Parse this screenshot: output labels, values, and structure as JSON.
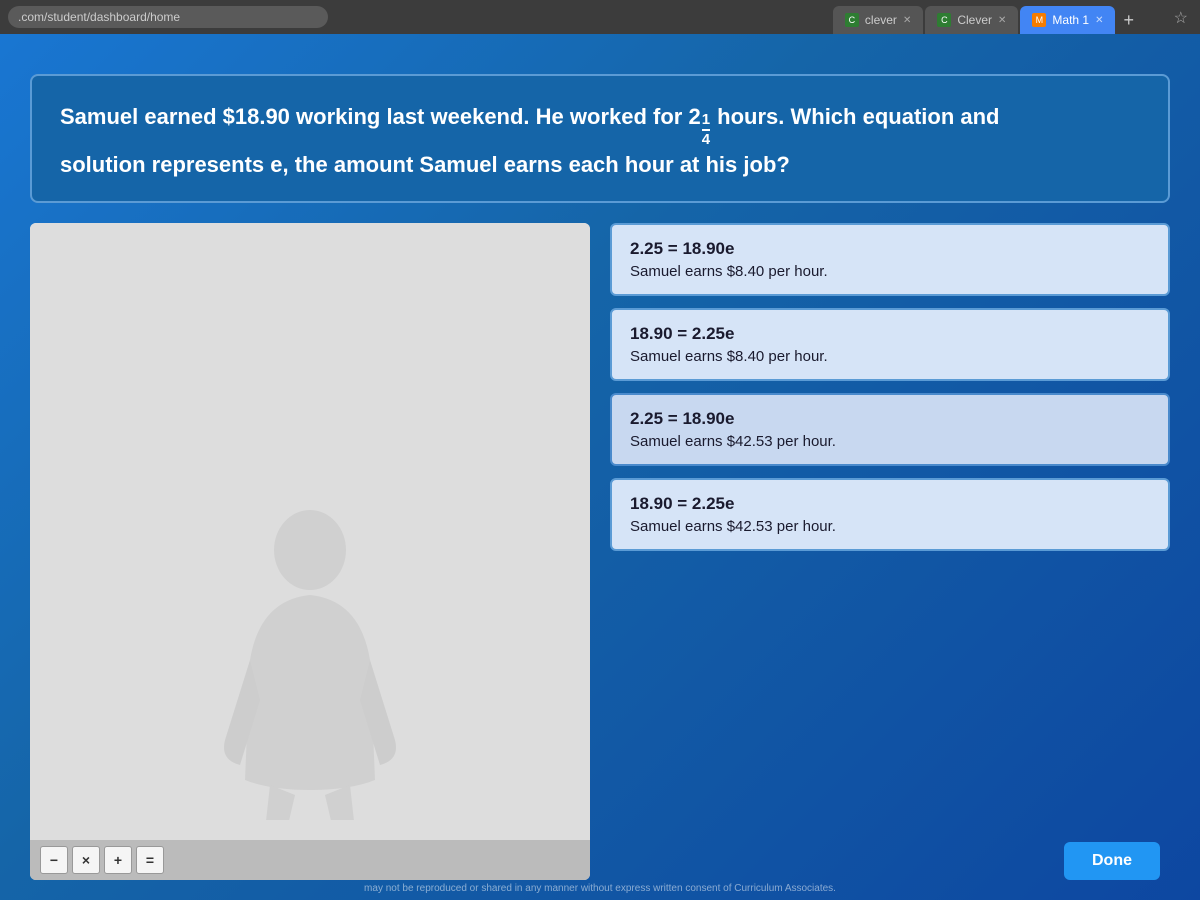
{
  "browser": {
    "url": ".com/student/dashboard/home",
    "tabs": [
      {
        "label": "clever",
        "favicon": "C",
        "faviconColor": "green",
        "active": false
      },
      {
        "label": "Clever",
        "favicon": "C",
        "faviconColor": "green",
        "active": false
      },
      {
        "label": "Math 1",
        "favicon": "M",
        "faviconColor": "orange",
        "active": true
      }
    ],
    "plus_label": "+"
  },
  "question": {
    "text_part1": "Samuel earned $18.90 working last weekend. He worked for 2",
    "fraction_numerator": "1",
    "fraction_denominator": "4",
    "text_part2": " hours. Which equation and",
    "text_part3": "solution represents e, the amount Samuel earns each hour at his job?"
  },
  "answers": [
    {
      "equation": "2.25 = 18.90e",
      "solution": "Samuel earns $8.40 per hour."
    },
    {
      "equation": "18.90 = 2.25e",
      "solution": "Samuel earns $8.40 per hour."
    },
    {
      "equation": "2.25 = 18.90e",
      "solution": "Samuel earns $42.53 per hour."
    },
    {
      "equation": "18.90 = 2.25e",
      "solution": "Samuel earns $42.53 per hour."
    }
  ],
  "calculator": {
    "buttons": [
      "−",
      "×",
      "+",
      "="
    ]
  },
  "footer": {
    "text": "may not be reproduced or shared in any manner without express written consent of Curriculum Associates."
  },
  "buttons": {
    "done": "Done"
  }
}
